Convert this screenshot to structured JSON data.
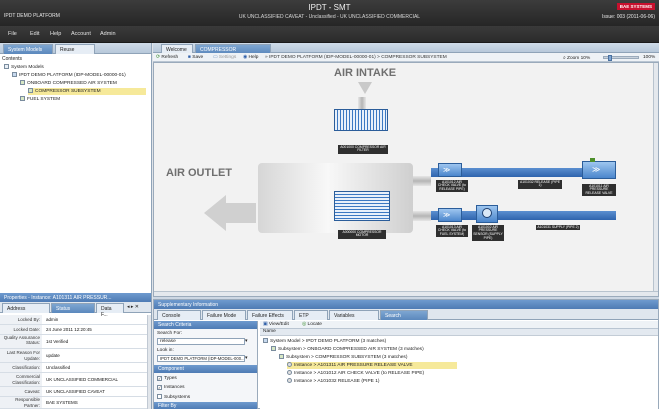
{
  "title_bar": {
    "window_title": "IPDT DEMO PLATFORM",
    "app_name": "IPDT - SMT",
    "caveat": "UK UNCLASSIFIED CAVEAT - Unclassified - UK UNCLASSIFIED COMMERCIAL",
    "brand": "BAE SYSTEMS",
    "issue": "Issue: 003 (2011-06-06)"
  },
  "menu": [
    "File",
    "Edit",
    "Help",
    "Account",
    "Admin"
  ],
  "left_panel": {
    "tabs": [
      "System Models",
      "Reuse"
    ],
    "contents_label": "Contents",
    "tree": [
      {
        "label": "System Models",
        "level": 0,
        "selected": false
      },
      {
        "label": "IPDT DEMO PLATFORM (IDP-MODEL-00000-01)",
        "level": 1,
        "selected": false
      },
      {
        "label": "ONBOARD COMPRESSED AIR SYSTEM",
        "level": 2,
        "selected": false
      },
      {
        "label": "COMPRESSOR SUBSYSTEM",
        "level": 3,
        "selected": true
      },
      {
        "label": "FUEL SYSTEM",
        "level": 2,
        "selected": false
      }
    ],
    "properties_header": "Properties - Instance: A101311 AIR PRESSUR...",
    "prop_tabs": [
      "Address",
      "Status",
      "Data F..."
    ],
    "properties": [
      {
        "key": "Locked By:",
        "value": "admin"
      },
      {
        "key": "Locked Date:",
        "value": "24 June 2011 12:20:45"
      },
      {
        "key": "Quality Assurance Status:",
        "value": "1st Verified"
      },
      {
        "key": "Last Reason For Update:",
        "value": "update"
      },
      {
        "key": "Classification:",
        "value": "Unclassified"
      },
      {
        "key": "Commercial Classification:",
        "value": "UK UNCLASSIFIED COMMERCIAL"
      },
      {
        "key": "Caveat:",
        "value": "UK UNCLASSIFIED CAVEAT"
      },
      {
        "key": "Responsible Partner:",
        "value": "BAE SYSTEMS"
      }
    ]
  },
  "main": {
    "tabs": [
      "Welcome",
      "COMPRESSOR SUBSYSTEM"
    ],
    "toolbar": {
      "refresh": "Refresh",
      "save": "Save",
      "settings": "Settings",
      "help": "Help",
      "breadcrumb": "IPDT DEMO PLATFORM (IDP-MODEL-00000-01) > COMPRESSOR SUBSYSTEM",
      "zoom_label": "Zoom",
      "zoom_min": "10%",
      "zoom_max": "100%"
    },
    "diagram": {
      "air_intake": "AIR INTAKE",
      "air_outlet": "AIR OUTLET",
      "components": {
        "filter": "A001000 COMPRESSOR AIR FILTER",
        "motor": "A000000 COMPRESSOR MOTOR",
        "check_valve_release": "A101012 AIR CHECK VALVE (to RELEASE PIPE)",
        "release_pipe": "A101032 RELEASE (PIPE 1)",
        "pressure_release_valve": "A101011 AIR PRESSURE RELEASE VALVE",
        "check_valve_fuel": "A101013 AIR CHECK VALVE (to FUEL SYSTEM)",
        "pressure_sensor": "A101002 AIR PRESSURE SENSOR (SUPPLY PIPE)",
        "supply_pipe": "A101031 SUPPLY (PIPE 2)"
      }
    },
    "supplementary": {
      "header": "Supplementary Information",
      "tabs": [
        "Console",
        "Failure Mode",
        "Failure Effects",
        "ETP",
        "Variables",
        "Search"
      ],
      "active_tab": "Search",
      "search": {
        "criteria_header": "Search Criteria",
        "search_for_label": "Search For:",
        "search_for_value": "release",
        "look_in_label": "Look in:",
        "look_in_value": "IPDT DEMO PLATFORM (IDP-MODEL-000...",
        "component_header": "Component",
        "checks": [
          {
            "label": "Types",
            "checked": true
          },
          {
            "label": "Instances",
            "checked": true
          },
          {
            "label": "Subsystems",
            "checked": false
          }
        ],
        "filter_header": "Filter By"
      },
      "results": {
        "toolbar_view": "View/Edit",
        "toolbar_locate": "Locate",
        "header": "Name",
        "rows": [
          {
            "text": "System Model > IPDT DEMO PLATFORM (3 matches)",
            "level": 0,
            "selected": false
          },
          {
            "text": "Subsystem > ONBOARD COMPRESSED AIR SYSTEM (3 matches)",
            "level": 1,
            "selected": false
          },
          {
            "text": "Subsystem > COMPRESSOR SUBSYSTEM (3 matches)",
            "level": 2,
            "selected": false
          },
          {
            "text": "Instance > A101311 AIR PRESSURE RELEASE VALVE",
            "level": 3,
            "selected": true
          },
          {
            "text": "Instance > A101012 AIR CHECK VALVE (to RELEASE PIPE)",
            "level": 3,
            "selected": false
          },
          {
            "text": "Instance > A101032 RELEASE (PIPE 1)",
            "level": 3,
            "selected": false
          }
        ]
      }
    }
  }
}
